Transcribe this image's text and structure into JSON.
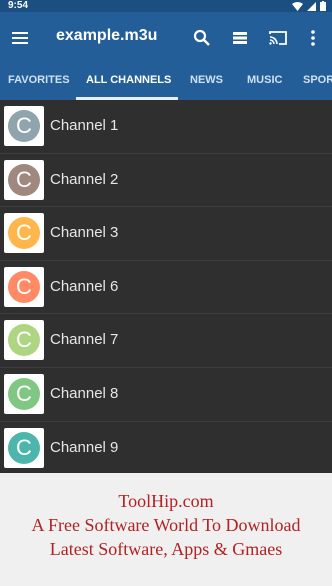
{
  "status": {
    "time": "9:54"
  },
  "appbar": {
    "title": "example.m3u"
  },
  "tabs": [
    {
      "label": "FAVORITES"
    },
    {
      "label": "ALL CHANNELS"
    },
    {
      "label": "NEWS"
    },
    {
      "label": "MUSIC"
    },
    {
      "label": "SPOR"
    }
  ],
  "channels": [
    {
      "letter": "C",
      "name": "Channel 1",
      "color": "#8fa4ad"
    },
    {
      "letter": "C",
      "name": "Channel 2",
      "color": "#a1887f"
    },
    {
      "letter": "C",
      "name": "Channel 3",
      "color": "#ffb74d"
    },
    {
      "letter": "C",
      "name": "Channel 6",
      "color": "#ff8a65"
    },
    {
      "letter": "C",
      "name": "Channel 7",
      "color": "#aed581"
    },
    {
      "letter": "C",
      "name": "Channel 8",
      "color": "#81c784"
    },
    {
      "letter": "C",
      "name": "Channel 9",
      "color": "#4db6ac"
    }
  ],
  "ad": {
    "line1": "ToolHip.com",
    "line2": "A Free Software World To Download",
    "line3": "Latest Software, Apps & Gmaes"
  },
  "colors": {
    "appbar": "#235e99",
    "statusbar": "#1b4f82",
    "row": "#2f2f2f"
  },
  "icons": [
    "wifi-icon",
    "signal-icon",
    "battery-icon",
    "menu-icon",
    "search-icon",
    "list-view-icon",
    "cast-icon",
    "more-vert-icon"
  ]
}
